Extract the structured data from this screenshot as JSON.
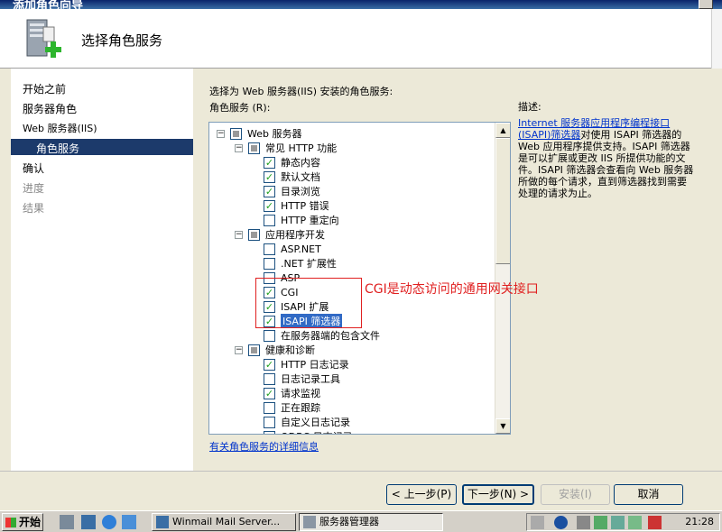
{
  "window": {
    "title": "添加角色向导"
  },
  "header": {
    "title": "选择角色服务"
  },
  "nav": {
    "items": [
      {
        "label": "开始之前",
        "state": "normal"
      },
      {
        "label": "服务器角色",
        "state": "normal"
      },
      {
        "label": "Web 服务器(IIS)",
        "state": "normal"
      },
      {
        "label": "角色服务",
        "state": "selected"
      },
      {
        "label": "确认",
        "state": "normal"
      },
      {
        "label": "进度",
        "state": "disabled"
      },
      {
        "label": "结果",
        "state": "disabled"
      }
    ]
  },
  "main": {
    "instruction": "选择为 Web 服务器(IIS) 安装的角色服务:",
    "role_services_label": "角色服务 (R):",
    "tree": [
      {
        "label": "Web 服务器",
        "level": 0,
        "expander": "minus",
        "check": "partial"
      },
      {
        "label": "常见 HTTP 功能",
        "level": 1,
        "expander": "minus",
        "check": "partial"
      },
      {
        "label": "静态内容",
        "level": 2,
        "check": "checked"
      },
      {
        "label": "默认文档",
        "level": 2,
        "check": "checked"
      },
      {
        "label": "目录浏览",
        "level": 2,
        "check": "checked"
      },
      {
        "label": "HTTP 错误",
        "level": 2,
        "check": "checked"
      },
      {
        "label": "HTTP 重定向",
        "level": 2,
        "check": "unchecked"
      },
      {
        "label": "应用程序开发",
        "level": 1,
        "expander": "minus",
        "check": "partial"
      },
      {
        "label": "ASP.NET",
        "level": 2,
        "check": "unchecked"
      },
      {
        "label": ".NET 扩展性",
        "level": 2,
        "check": "unchecked"
      },
      {
        "label": "ASP",
        "level": 2,
        "check": "unchecked"
      },
      {
        "label": "CGI",
        "level": 2,
        "check": "checked"
      },
      {
        "label": "ISAPI 扩展",
        "level": 2,
        "check": "checked"
      },
      {
        "label": "ISAPI 筛选器",
        "level": 2,
        "check": "checked",
        "selected": true
      },
      {
        "label": "在服务器端的包含文件",
        "level": 2,
        "check": "unchecked"
      },
      {
        "label": "健康和诊断",
        "level": 1,
        "expander": "minus",
        "check": "partial"
      },
      {
        "label": "HTTP 日志记录",
        "level": 2,
        "check": "checked"
      },
      {
        "label": "日志记录工具",
        "level": 2,
        "check": "unchecked"
      },
      {
        "label": "请求监视",
        "level": 2,
        "check": "checked"
      },
      {
        "label": "正在跟踪",
        "level": 2,
        "check": "unchecked"
      },
      {
        "label": "自定义日志记录",
        "level": 2,
        "check": "unchecked"
      },
      {
        "label": "ODBC 日志记录",
        "level": 2,
        "check": "unchecked"
      }
    ],
    "description_label": "描述:",
    "description_link": "Internet 服务器应用程序编程接口(ISAPI)筛选器",
    "description_text": "对使用 ISAPI 筛选器的 Web 应用程序提供支持。ISAPI 筛选器是可以扩展或更改 IIS 所提供功能的文件。ISAPI 筛选器会查看向 Web 服务器所做的每个请求，直到筛选器找到需要处理的请求为止。",
    "more_info_link": "有关角色服务的详细信息",
    "annotation": "CGI是动态访问的通用网关接口"
  },
  "buttons": {
    "back": "< 上一步(P)",
    "next": "下一步(N) >",
    "install": "安装(I)",
    "cancel": "取消"
  },
  "taskbar": {
    "start": "开始",
    "tasks": [
      {
        "label": "Winmail Mail Server...",
        "active": false
      },
      {
        "label": "服务器管理器",
        "active": true
      }
    ],
    "clock": "21:28"
  },
  "colors": {
    "nav_selected": "#1c3a6b",
    "link": "#0033cc",
    "annotation": "#e02020",
    "highlight": "#316ac5"
  }
}
